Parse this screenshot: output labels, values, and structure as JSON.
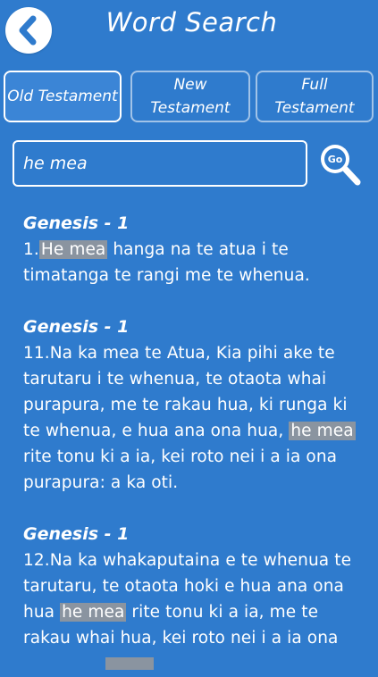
{
  "header": {
    "title": "Word Search"
  },
  "tabs": [
    {
      "label": "Old Testament",
      "selected": true
    },
    {
      "label_line1": "New",
      "label_line2": "Testament",
      "selected": false
    },
    {
      "label_line1": "Full",
      "label_line2": "Testament",
      "selected": false
    }
  ],
  "search": {
    "value": "he mea",
    "go_label": "Go"
  },
  "results": [
    {
      "ref": "Genesis - 1",
      "before": "1.",
      "match": "He mea",
      "after": " hanga na te atua i te timatanga te rangi me te whenua."
    },
    {
      "ref": "Genesis - 1",
      "before": "11.Na ka mea te Atua, Kia pihi ake te tarutaru i te whenua, te otaota whai purapura, me te rakau hua, ki runga ki te whenua, e hua ana ona hua, ",
      "match": "he mea",
      "after": " rite tonu ki a ia, kei roto nei i a ia ona purapura: a ka oti."
    },
    {
      "ref": "Genesis - 1",
      "before": "12.Na ka whakaputaina e te whenua te tarutaru, te otaota hoki e hua ana ona hua ",
      "match": "he mea",
      "after": " rite tonu ki a ia, me te rakau whai hua, kei roto nei i a ia ona"
    }
  ],
  "colors": {
    "background": "#2f7bcd",
    "highlight": "#8a94a0",
    "text": "#ffffff"
  },
  "icons": {
    "back": "chevron-left-icon",
    "go": "magnifier-go-icon"
  }
}
